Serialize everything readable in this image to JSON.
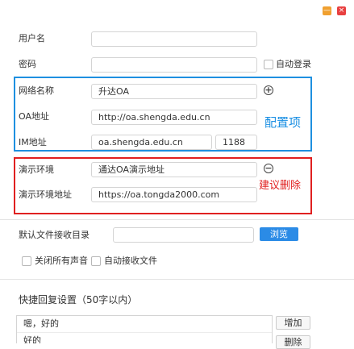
{
  "window": {
    "minimize_icon": "minimize-icon",
    "close_icon": "close-icon",
    "minimize_glyph": "—",
    "close_glyph": "×",
    "minimize_color": "#f0a030",
    "close_color": "#e84040"
  },
  "login": {
    "username_label": "用户名",
    "username_value": "",
    "password_label": "密码",
    "password_value": "",
    "auto_login_label": "自动登录"
  },
  "network": {
    "name_label": "网络名称",
    "name_value": "升达OA",
    "add_glyph": "+",
    "oa_label": "OA地址",
    "oa_value": "http://oa.shengda.edu.cn",
    "im_label": "IM地址",
    "im_value": "oa.shengda.edu.cn",
    "im_port": "1188",
    "annotation": "配置项",
    "annotation_color": "#1a8fe3"
  },
  "demo": {
    "env_label": "演示环境",
    "env_value": "通达OA演示地址",
    "remove_glyph": "−",
    "addr_label": "演示环境地址",
    "addr_value": "https://oa.tongda2000.com",
    "annotation": "建议删除",
    "annotation_color": "#e02020"
  },
  "files": {
    "dir_label": "默认文件接收目录",
    "dir_value": "",
    "browse_label": "浏览",
    "mute_label": "关闭所有声音",
    "auto_receive_label": "自动接收文件"
  },
  "quick_reply": {
    "title": "快捷回复设置（50字以内）",
    "items": [
      "嗯，好的",
      "好的"
    ],
    "add_label": "增加",
    "delete_label": "删除"
  }
}
